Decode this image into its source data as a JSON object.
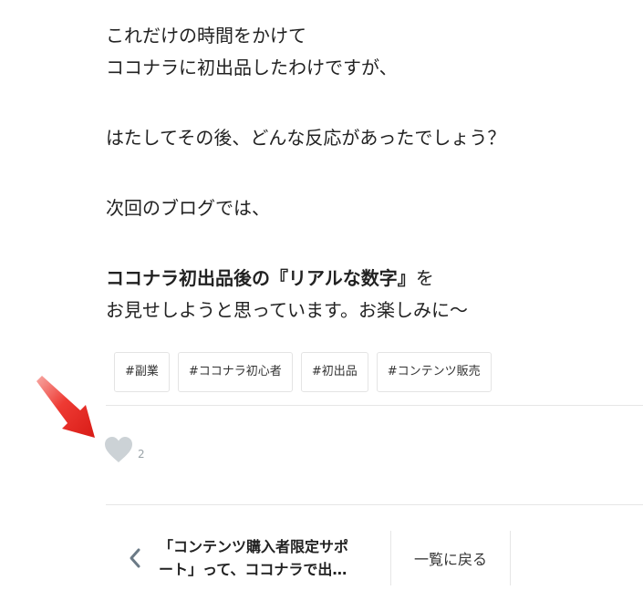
{
  "article": {
    "lines": [
      "これだけの時間をかけて",
      "ココナラに初出品したわけですが、",
      "はたしてその後、どんな反応があったでしょう？",
      "次回のブログでは、",
      "を",
      "お見せしようと思っています。お楽しみに〜"
    ],
    "bold_phrase": "ココナラ初出品後の『リアルな数字』"
  },
  "tags": [
    "#副業",
    "#ココナラ初心者",
    "#初出品",
    "#コンテンツ販売"
  ],
  "like": {
    "count": "2",
    "icon": "heart-icon"
  },
  "annotation": {
    "icon": "red-arrow-icon",
    "color": "#e8231e"
  },
  "pager": {
    "prev_icon": "chevron-left-icon",
    "prev_title_line1": "「コンテンツ購入者限定サポ",
    "prev_title_line2": "ート」って、ココナラで出…",
    "back_label": "一覧に戻る"
  }
}
